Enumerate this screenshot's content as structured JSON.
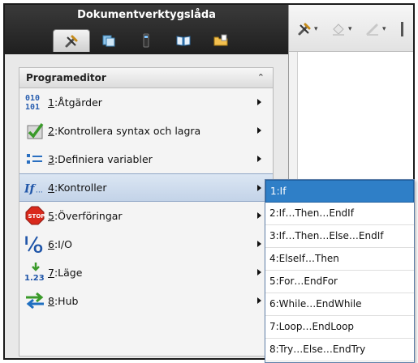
{
  "toolbox": {
    "title": "Dokumentverktygslåda",
    "tabs": [
      {
        "icon": "tools-icon",
        "active": true
      },
      {
        "icon": "catalog-icon",
        "active": false
      },
      {
        "icon": "calculator-icon",
        "active": false
      },
      {
        "icon": "book-icon",
        "active": false
      },
      {
        "icon": "folder-icon",
        "active": false
      }
    ],
    "section_title": "Programeditor",
    "collapse_glyph": "⌃"
  },
  "menu": {
    "items": [
      {
        "num": "1",
        "label": "Åtgärder",
        "icon": "binary-icon"
      },
      {
        "num": "2",
        "label": "Kontrollera syntax och lagra",
        "icon": "check-syntax-icon"
      },
      {
        "num": "3",
        "label": "Definiera variabler",
        "icon": "define-variables-icon"
      },
      {
        "num": "4",
        "label": "Kontroller",
        "icon": "if-control-icon",
        "active": true
      },
      {
        "num": "5",
        "label": "Överföringar",
        "icon": "stop-icon"
      },
      {
        "num": "6",
        "label": "I/O",
        "icon": "io-icon"
      },
      {
        "num": "7",
        "label": "Läge",
        "icon": "mode-icon"
      },
      {
        "num": "8",
        "label": "Hub",
        "icon": "hub-icon"
      }
    ]
  },
  "submenu": {
    "items": [
      {
        "label": "1:If",
        "active": true
      },
      {
        "label": "2:If…Then…EndIf"
      },
      {
        "label": "3:If…Then…Else…EndIf"
      },
      {
        "label": "4:ElseIf…Then"
      },
      {
        "label": "5:For…EndFor"
      },
      {
        "label": "6:While…EndWhile"
      },
      {
        "label": "7:Loop…EndLoop"
      },
      {
        "label": "8:Try…Else…EndTry"
      }
    ]
  },
  "colors": {
    "accent": "#2f7fc7",
    "header_dark": "#2a2a2a",
    "active_row": "#c8d6ea"
  }
}
